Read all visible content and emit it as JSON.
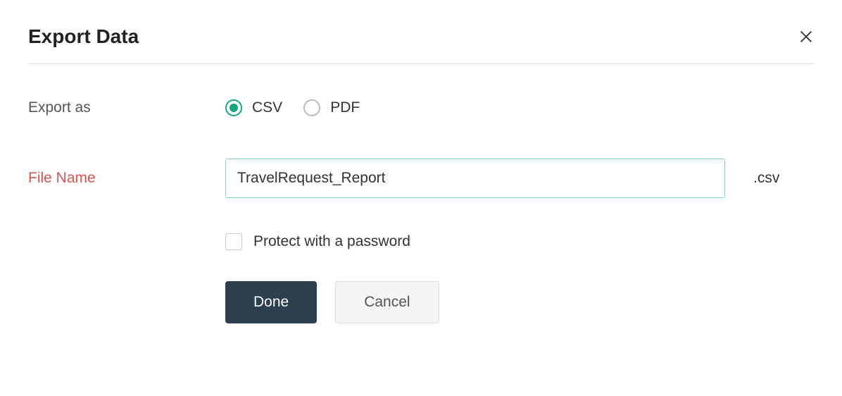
{
  "dialog": {
    "title": "Export Data"
  },
  "exportAs": {
    "label": "Export as",
    "options": {
      "csv": "CSV",
      "pdf": "PDF"
    },
    "selected": "csv"
  },
  "fileName": {
    "label": "File Name",
    "value": "TravelRequest_Report",
    "extension": ".csv"
  },
  "protect": {
    "label": "Protect with a password",
    "checked": false
  },
  "buttons": {
    "done": "Done",
    "cancel": "Cancel"
  }
}
